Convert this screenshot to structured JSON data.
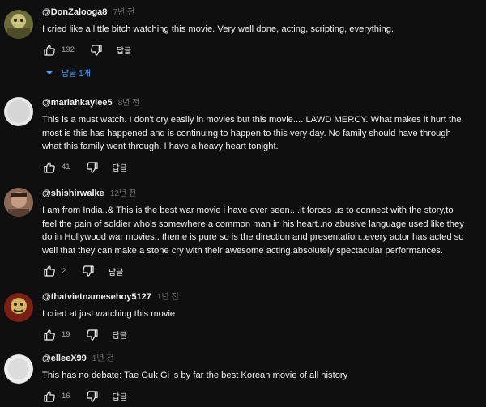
{
  "comments": [
    {
      "author": "@DonZalooga8",
      "time": "7년 전",
      "lines": [
        "I cried like a little bitch watching this movie. Very well done, acting, scripting, everything."
      ],
      "likes": "192",
      "reply_label": "답글",
      "replies_label": "답글 1개"
    },
    {
      "author": "@mariahkaylee5",
      "time": "8년 전",
      "lines": [
        "This is a must watch. I don't cry easily in movies but this movie.... LAWD MERCY. What makes it hurt the",
        "most is this has happened and is continuing to happen to this very day. No family should have through",
        "what this family went through. I have a heavy heart tonight."
      ],
      "likes": "41",
      "reply_label": "답글"
    },
    {
      "author": "@shishirwalke",
      "time": "12년 전",
      "lines": [
        "I am from India..& This is the best war movie i have ever seen....it forces us to connect with the story,to",
        "feel the pain of soldier who's somewhere a common man in his heart..no abusive language used like they",
        "do in Hollywood war movies.. theme is pure so is the direction and presentation..every actor has acted so",
        "well that they can make a stone cry with their awesome acting.absolutely spectacular performances."
      ],
      "likes": "2",
      "reply_label": "답글"
    },
    {
      "author": "@thatvietnamesehoy5127",
      "time": "1년 전",
      "lines": [
        "I cried at just watching this movie"
      ],
      "likes": "19",
      "reply_label": "답글"
    },
    {
      "author": "@elleeX99",
      "time": "1년 전",
      "lines": [
        "This has no debate: Tae Guk Gi is by far the best Korean movie of all history"
      ],
      "likes": "16",
      "reply_label": "답글"
    }
  ],
  "colors": {
    "background": "#0f0f0f",
    "text": "#f1f1f1",
    "secondary": "#aaaaaa",
    "timestamp": "#717171",
    "link": "#3ea6ff"
  },
  "icons": {
    "like": "thumbs-up-icon",
    "dislike": "thumbs-down-icon",
    "replies_toggle": "caret-down-icon"
  }
}
